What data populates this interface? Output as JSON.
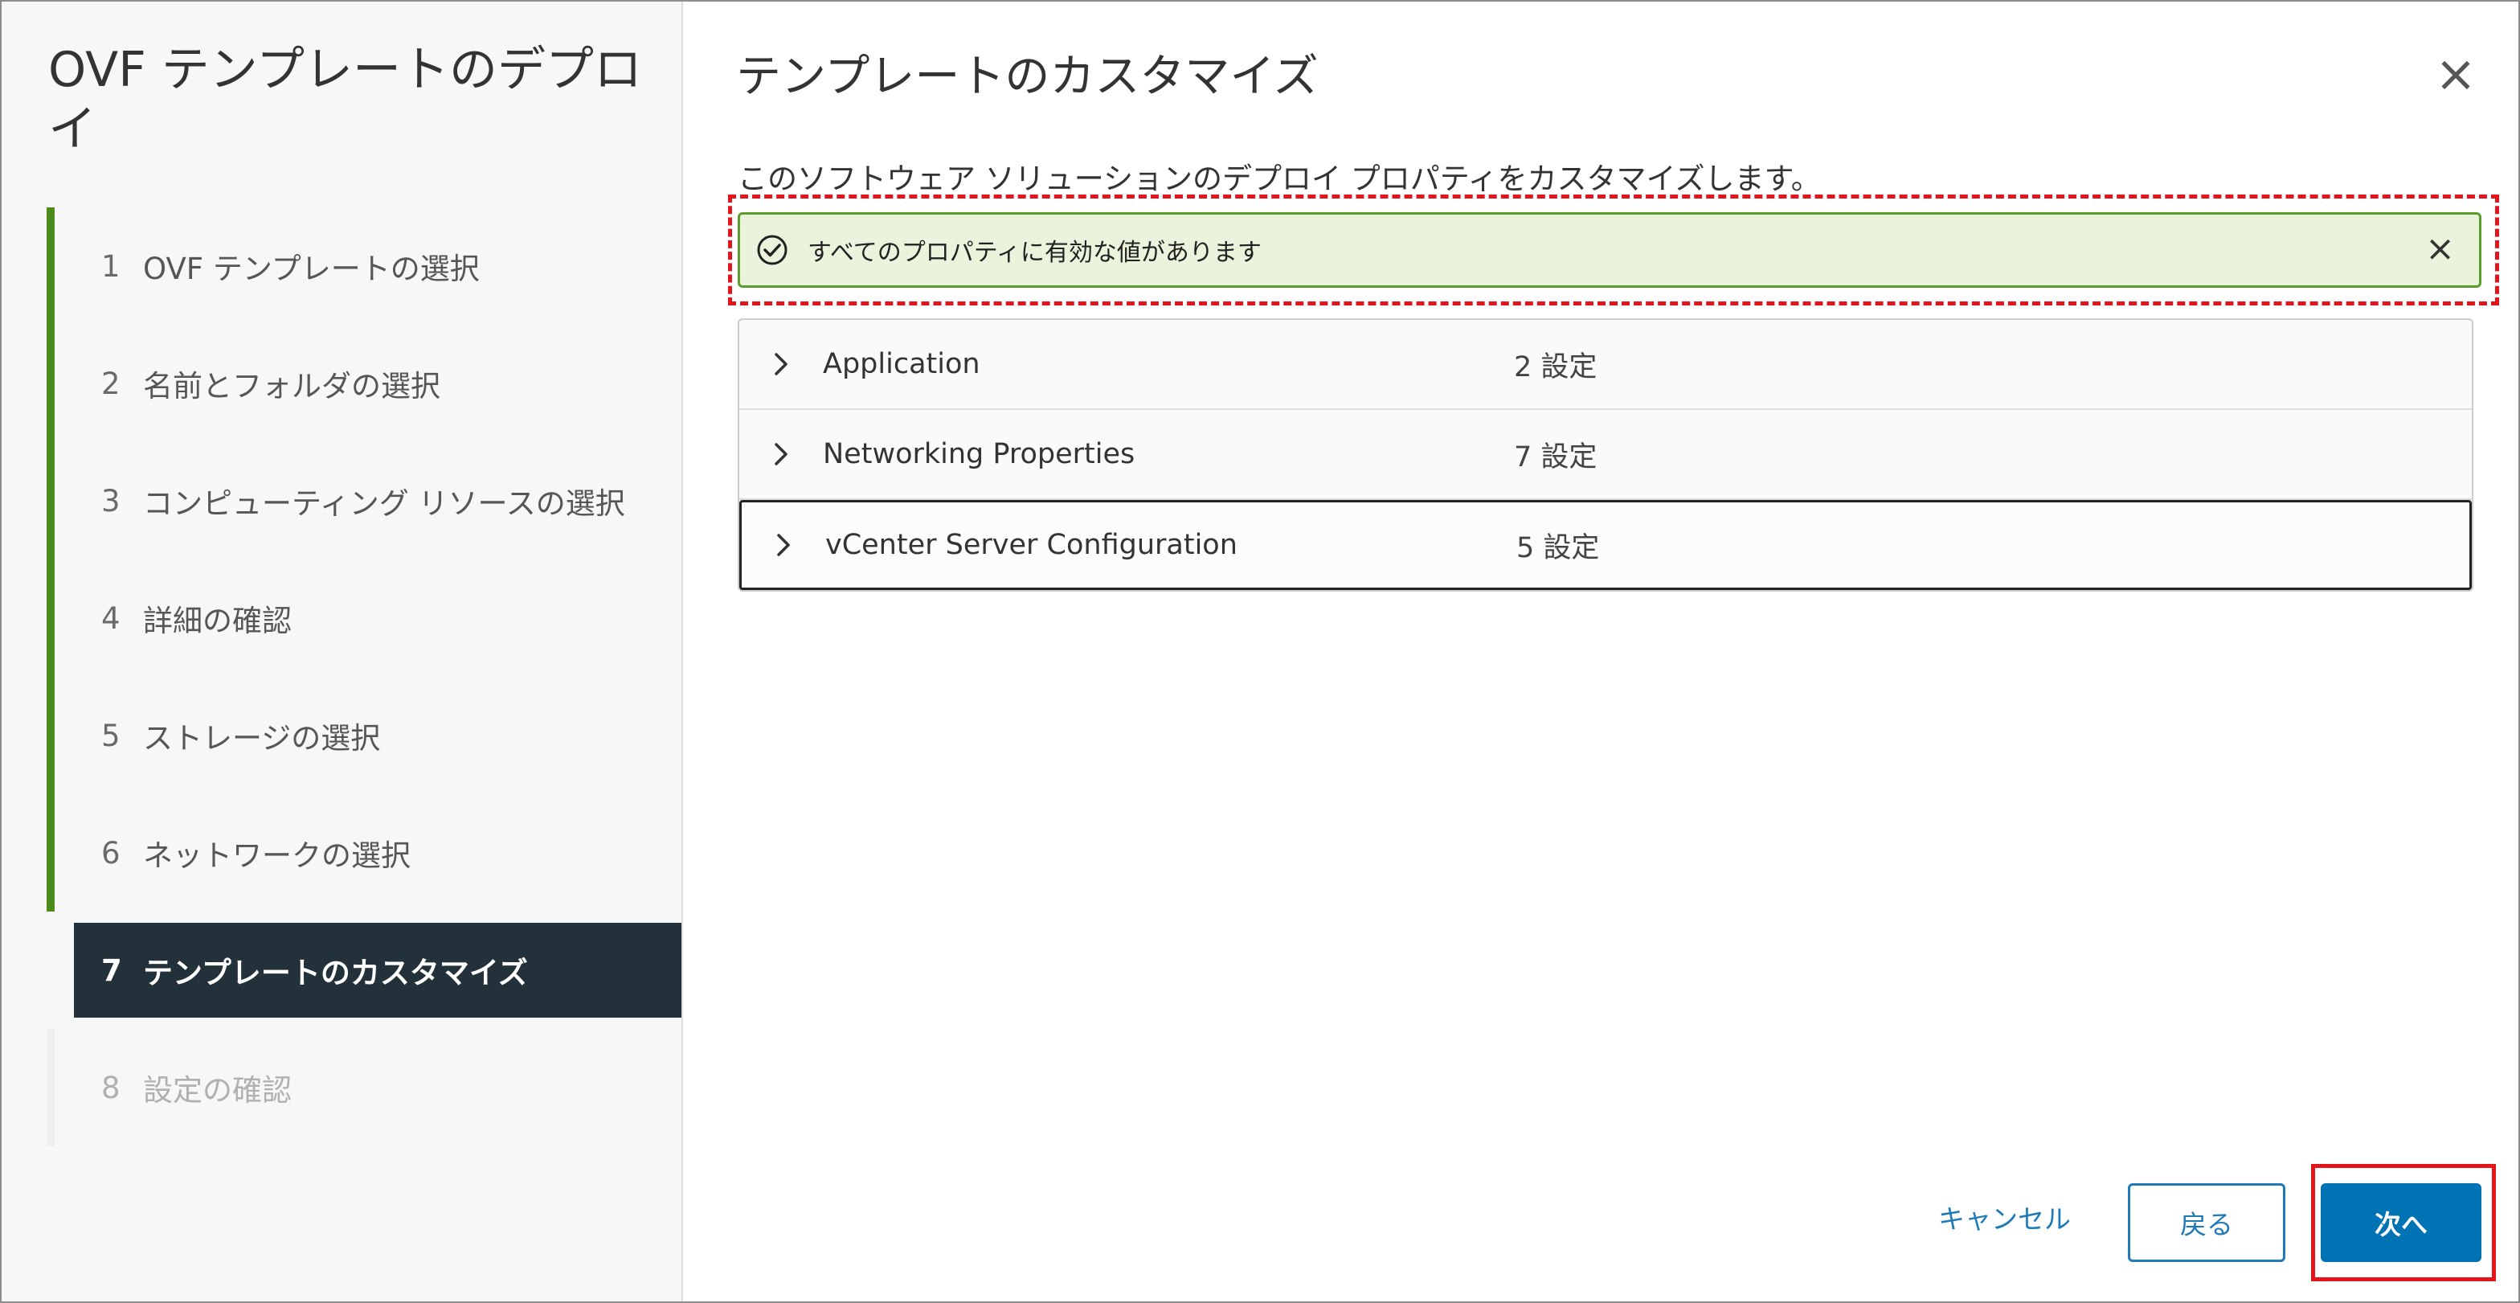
{
  "sidebar": {
    "title": "OVF テンプレートのデプロイ",
    "steps": [
      {
        "num": "1",
        "label": "OVF テンプレートの選択"
      },
      {
        "num": "2",
        "label": "名前とフォルダの選択"
      },
      {
        "num": "3",
        "label": "コンピューティング リソースの選択"
      },
      {
        "num": "4",
        "label": "詳細の確認"
      },
      {
        "num": "5",
        "label": "ストレージの選択"
      },
      {
        "num": "6",
        "label": "ネットワークの選択"
      },
      {
        "num": "7",
        "label": "テンプレートのカスタマイズ"
      },
      {
        "num": "8",
        "label": "設定の確認"
      }
    ]
  },
  "main": {
    "title": "テンプレートのカスタマイズ",
    "description": "このソフトウェア ソリューションのデプロイ プロパティをカスタマイズします。",
    "alert": {
      "text": "すべてのプロパティに有効な値があります",
      "close": "×",
      "icon": "check-circle-icon"
    },
    "sections": [
      {
        "label": "Application",
        "count": "2 設定"
      },
      {
        "label": "Networking Properties",
        "count": "7 設定"
      },
      {
        "label": "vCenter Server Configuration",
        "count": "5 設定"
      }
    ]
  },
  "close_icon": "×",
  "footer": {
    "cancel": "キャンセル",
    "back": "戻る",
    "next": "次へ"
  },
  "colors": {
    "accent": "#0073b5",
    "success": "#5b9e2d",
    "current_step_bg": "#22313a",
    "highlight": "#e3141b"
  }
}
